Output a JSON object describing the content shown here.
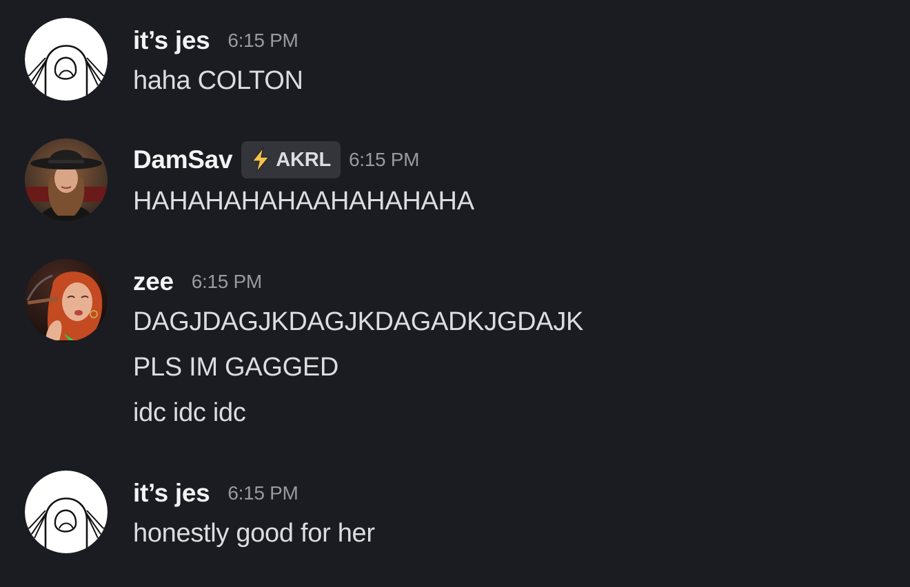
{
  "messages": [
    {
      "author": "it’s jes",
      "avatar_icon": "ghost-doodle-avatar",
      "timestamp": "6:15 PM",
      "lines": [
        "haha COLTON"
      ]
    },
    {
      "author": "DamSav",
      "avatar_icon": "woman-in-hat-avatar",
      "role_tag": {
        "icon": "lightning-bolt-icon",
        "label": "AKRL"
      },
      "timestamp": "6:15 PM",
      "lines": [
        "HAHAHAHAHAAHAHAHAHA"
      ]
    },
    {
      "author": "zee",
      "avatar_icon": "woman-smoking-avatar",
      "timestamp": "6:15 PM",
      "lines": [
        "DAGJDAGJKDAGJKDAGADKJGDAJK",
        "PLS IM GAGGED",
        "idc idc idc"
      ]
    },
    {
      "author": "it’s jes",
      "avatar_icon": "ghost-doodle-avatar",
      "timestamp": "6:15 PM",
      "lines": [
        "honestly good for her"
      ]
    }
  ],
  "colors": {
    "background": "#1b1c21",
    "text": "#dbdee1",
    "username": "#f2f3f5",
    "timestamp": "#989aa2",
    "tag_background": "#33353b",
    "bolt": "#f5c24a"
  }
}
